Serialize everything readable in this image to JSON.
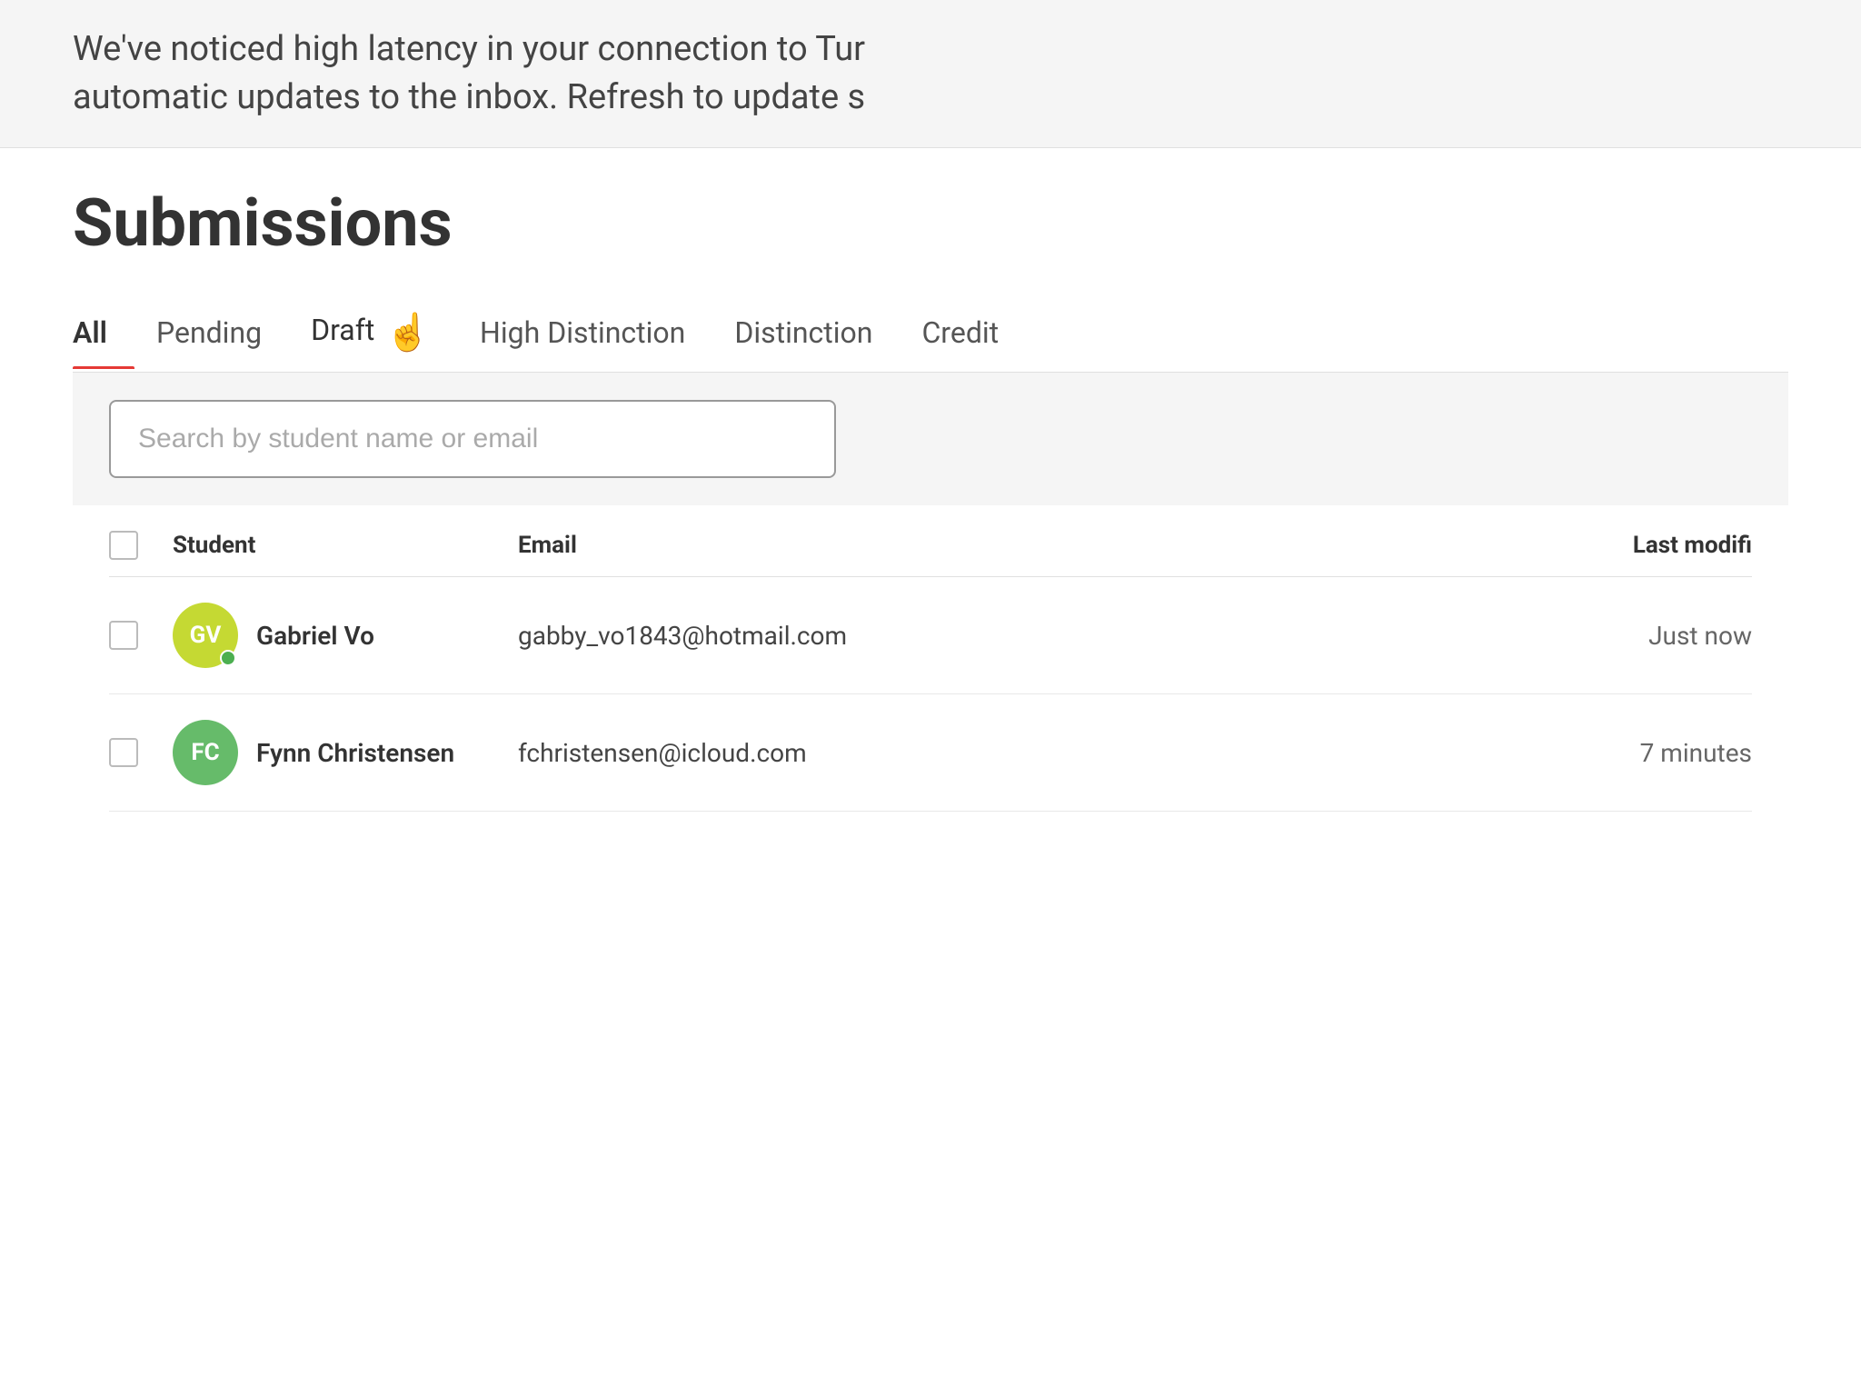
{
  "notice": {
    "line1": "We've noticed high latency in your connection to Tur",
    "line2": "automatic updates to the inbox. Refresh to update s"
  },
  "page": {
    "title": "Submissions"
  },
  "tabs": [
    {
      "id": "all",
      "label": "All",
      "active": true
    },
    {
      "id": "pending",
      "label": "Pending",
      "active": false
    },
    {
      "id": "draft",
      "label": "Draft",
      "active": false,
      "hovered": true
    },
    {
      "id": "high-distinction",
      "label": "High Distinction",
      "active": false
    },
    {
      "id": "distinction",
      "label": "Distinction",
      "active": false
    },
    {
      "id": "credit",
      "label": "Credit",
      "active": false
    }
  ],
  "search": {
    "placeholder": "Search by student name or email"
  },
  "table": {
    "headers": {
      "student": "Student",
      "email": "Email",
      "last_modified": "Last modifi"
    },
    "rows": [
      {
        "id": "gabriel-vo",
        "initials": "GV",
        "avatar_color": "#c5d933",
        "name": "Gabriel Vo",
        "email": "gabby_vo1843@hotmail.com",
        "last_modified": "Just now",
        "online": true
      },
      {
        "id": "fynn-christensen",
        "initials": "FC",
        "avatar_color": "#66bb6a",
        "name": "Fynn Christensen",
        "email": "fchristensen@icloud.com",
        "last_modified": "7 minutes",
        "online": false
      }
    ]
  }
}
